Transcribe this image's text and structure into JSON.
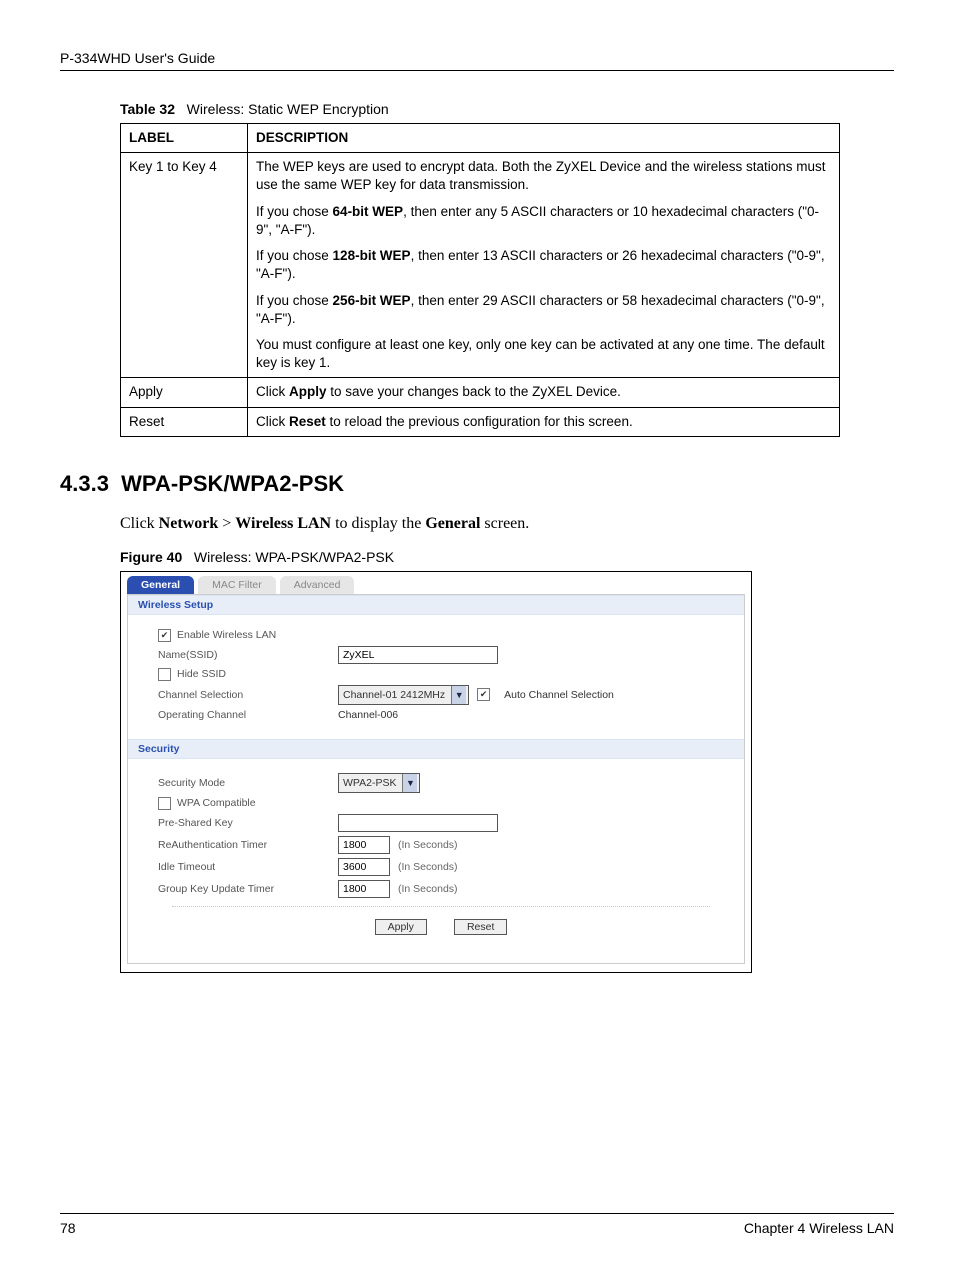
{
  "header": {
    "guide": "P-334WHD User's Guide"
  },
  "table": {
    "caption_label": "Table 32",
    "caption_text": "Wireless: Static WEP Encryption",
    "head": {
      "c1": "LABEL",
      "c2": "DESCRIPTION"
    },
    "rows": [
      {
        "label": "Key 1 to Key 4",
        "p1": "The WEP keys are used to encrypt data. Both the ZyXEL Device and the wireless stations must use the same WEP key for data transmission.",
        "p2a": "If you chose ",
        "p2b": "64-bit WEP",
        "p2c": ", then enter any 5 ASCII characters or 10 hexadecimal characters (\"0-9\", \"A-F\").",
        "p3a": "If you chose ",
        "p3b": "128-bit WEP",
        "p3c": ", then enter 13 ASCII characters or 26 hexadecimal characters (\"0-9\", \"A-F\").",
        "p4a": "If you chose ",
        "p4b": "256-bit WEP",
        "p4c": ", then enter 29 ASCII characters or 58 hexadecimal characters (\"0-9\", \"A-F\").",
        "p5": "You must configure at least one key, only one key can be activated at any one time. The default key is key 1."
      },
      {
        "label": "Apply",
        "d1": "Click ",
        "d2": "Apply",
        "d3": " to save your changes back to the ZyXEL Device."
      },
      {
        "label": "Reset",
        "d1": "Click ",
        "d2": "Reset",
        "d3": " to reload the previous configuration for this screen."
      }
    ]
  },
  "section": {
    "num": "4.3.3",
    "title": "WPA-PSK/WPA2-PSK"
  },
  "body": {
    "t1": "Click ",
    "t2": "Network",
    "t3": " > ",
    "t4": "Wireless LAN",
    "t5": " to display the ",
    "t6": "General",
    "t7": " screen."
  },
  "figure": {
    "label": "Figure 40",
    "text": "Wireless: WPA-PSK/WPA2-PSK"
  },
  "shot": {
    "tabs": {
      "general": "General",
      "mac": "MAC Filter",
      "adv": "Advanced"
    },
    "sec1": "Wireless Setup",
    "enable": "Enable Wireless LAN",
    "ssid_label": "Name(SSID)",
    "ssid_value": "ZyXEL",
    "hide": "Hide SSID",
    "chsel_label": "Channel Selection",
    "chsel_value": "Channel-01 2412MHz",
    "auto": "Auto Channel Selection",
    "opch_label": "Operating Channel",
    "opch_value": "Channel-006",
    "sec2": "Security",
    "mode_label": "Security Mode",
    "mode_value": "WPA2-PSK",
    "wpa_compat": "WPA Compatible",
    "psk_label": "Pre-Shared Key",
    "reauth_label": "ReAuthentication Timer",
    "reauth_value": "1800",
    "idle_label": "Idle Timeout",
    "idle_value": "3600",
    "gku_label": "Group Key Update Timer",
    "gku_value": "1800",
    "seconds": "(In Seconds)",
    "apply": "Apply",
    "reset": "Reset"
  },
  "footer": {
    "page": "78",
    "chapter": "Chapter 4 Wireless LAN"
  }
}
